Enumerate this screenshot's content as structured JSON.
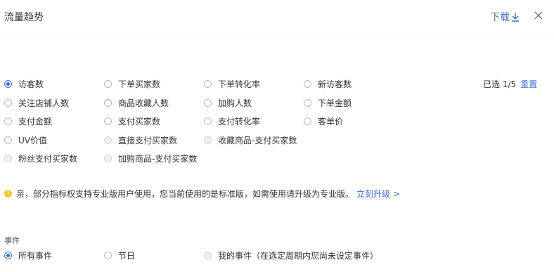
{
  "header": {
    "title": "流量趋势",
    "download_label": "下载"
  },
  "metrics": {
    "row1": [
      "访客数",
      "下单买家数",
      "下单转化率",
      "新访客数"
    ],
    "row2": [
      "关注店铺人数",
      "商品收藏人数",
      "加购人数",
      "下单金额"
    ],
    "row3": [
      "支付金额",
      "支付买家数",
      "支付转化率",
      "客单价"
    ],
    "row4": [
      "UV价值",
      "直接支付买家数",
      "收藏商品-支付买家数"
    ],
    "row5": [
      "粉丝支付买家数",
      "加购商品-支付买家数"
    ],
    "selected_count": "已选 1/5",
    "reset_label": "重置"
  },
  "notice": {
    "text": "亲，部分指标权支持专业版用户使用，您当前使用的是标准版，如需使用请升级为专业版。",
    "link": "立刻升级 >"
  },
  "events": {
    "label": "事件",
    "options": [
      "所有事件",
      "节日",
      "我的事件（在选定周期内您尚未设定事件）"
    ]
  },
  "colors": {
    "accent": "#3a6ec4",
    "warning": "#f7c623"
  }
}
